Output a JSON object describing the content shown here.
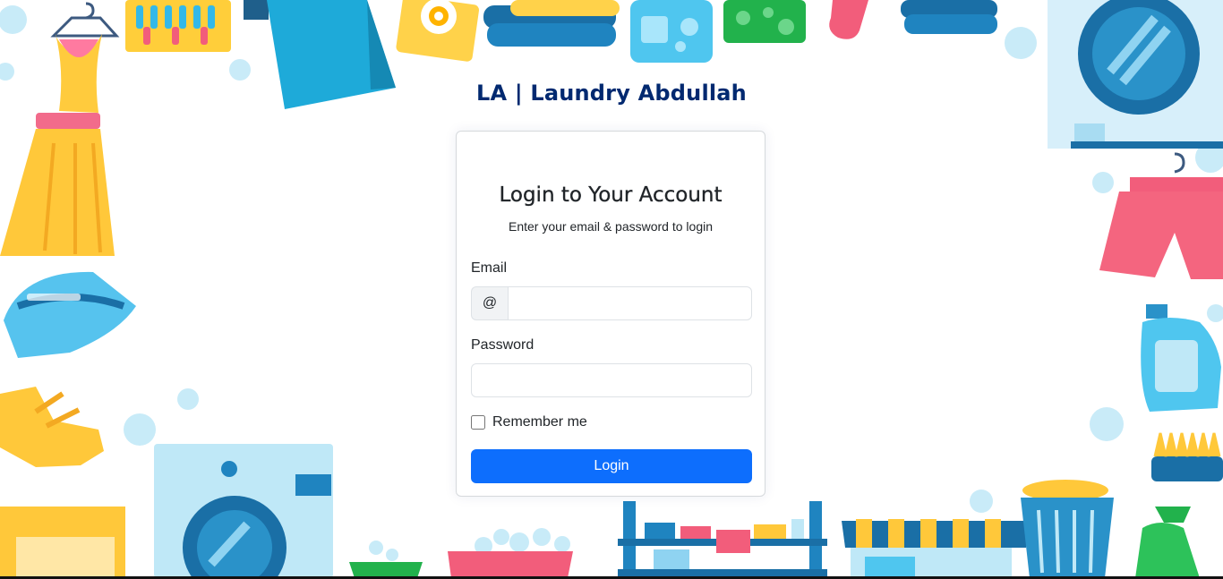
{
  "brand": {
    "title": "LA | Laundry Abdullah"
  },
  "login": {
    "title": "Login to Your Account",
    "subtitle": "Enter your email & password to login",
    "email_label": "Email",
    "email_prefix": "@",
    "email_value": "",
    "password_label": "Password",
    "password_value": "",
    "remember_label": "Remember me",
    "remember_checked": false,
    "submit_label": "Login"
  },
  "colors": {
    "brand_text": "#012970",
    "primary_button": "#0d6efd",
    "card_border": "#d6d9dc"
  },
  "background": {
    "icons": [
      "dress-icon",
      "laundry-basket-icon",
      "blue-dress-icon",
      "soap-box-icon",
      "folded-towels-icon",
      "detergent-bottle-icon",
      "sponge-icon",
      "glove-icon",
      "washing-machine-icon",
      "shorts-icon",
      "iron-icon",
      "rubber-gloves-icon",
      "bubbles-icon",
      "detergent-jug-icon",
      "brush-icon",
      "shelf-icon",
      "shop-awning-icon",
      "spray-bottle-icon"
    ]
  }
}
